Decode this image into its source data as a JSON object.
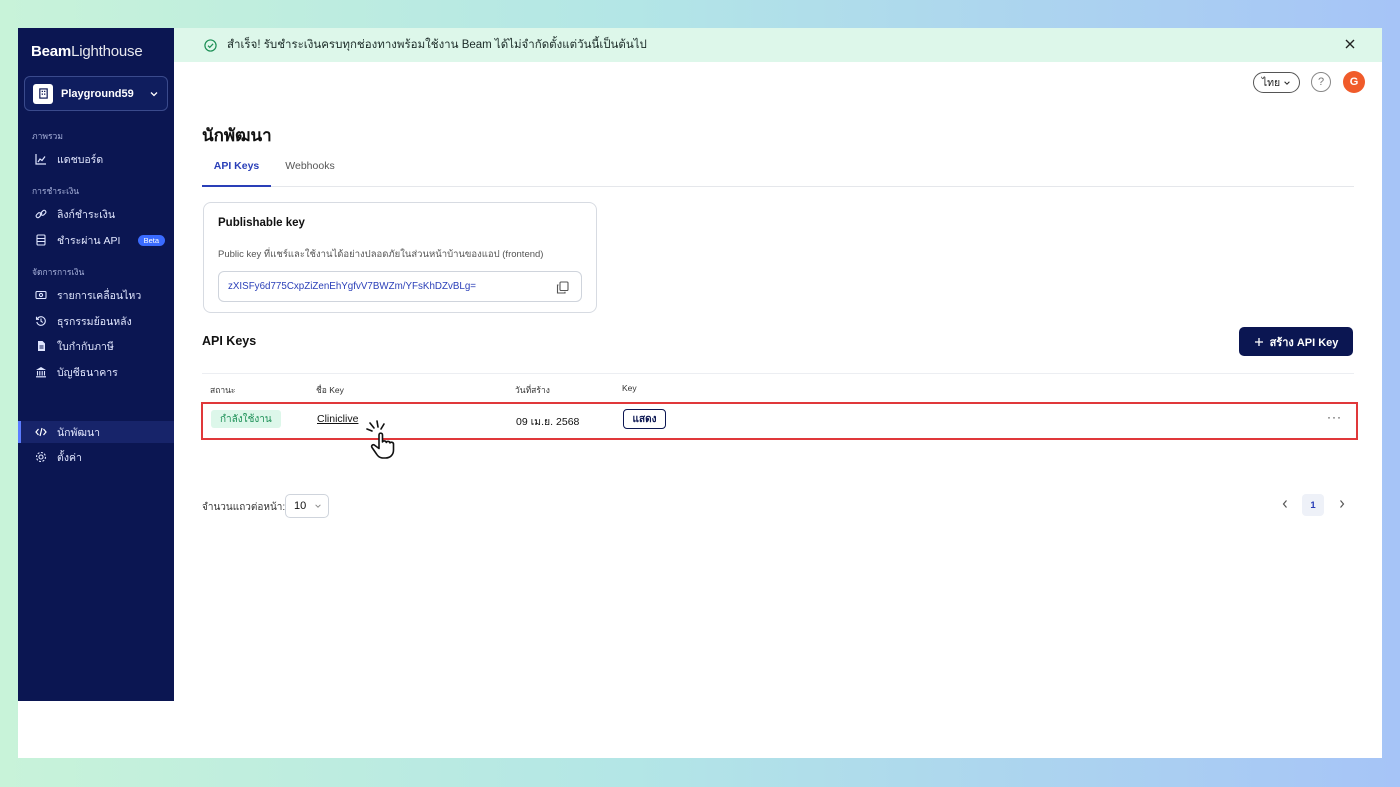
{
  "brand": {
    "bold": "Beam",
    "light": "Lighthouse"
  },
  "workspace": {
    "name": "Playground59"
  },
  "sidebar": {
    "groups": [
      {
        "title": "ภาพรวม",
        "items": [
          {
            "label": "แดชบอร์ด",
            "icon": "chart-icon"
          }
        ]
      },
      {
        "title": "การชำระเงิน",
        "items": [
          {
            "label": "ลิงก์ชำระเงิน",
            "icon": "link-icon"
          },
          {
            "label": "ชำระผ่าน API",
            "icon": "database-icon",
            "badge": "Beta"
          }
        ]
      },
      {
        "title": "จัดการการเงิน",
        "items": [
          {
            "label": "รายการเคลื่อนไหว",
            "icon": "money-icon"
          },
          {
            "label": "ธุรกรรมย้อนหลัง",
            "icon": "history-icon"
          },
          {
            "label": "ใบกำกับภาษี",
            "icon": "document-icon"
          },
          {
            "label": "บัญชีธนาคาร",
            "icon": "bank-icon"
          }
        ]
      }
    ],
    "bottom": [
      {
        "label": "นักพัฒนา",
        "icon": "code-icon",
        "active": true
      },
      {
        "label": "ตั้งค่า",
        "icon": "gear-icon"
      }
    ]
  },
  "banner": {
    "text": "สำเร็จ! รับชำระเงินครบทุกช่องทางพร้อมใช้งาน Beam ได้ไม่จำกัดตั้งแต่วันนี้เป็นต้นไป"
  },
  "topbar": {
    "language": "ไทย",
    "help": "?",
    "avatar": "G"
  },
  "page": {
    "title": "นักพัฒนา",
    "tabs": [
      {
        "label": "API Keys",
        "active": true
      },
      {
        "label": "Webhooks"
      }
    ]
  },
  "publishable": {
    "title": "Publishable key",
    "description": "Public key ที่แชร์และใช้งานได้อย่างปลอดภัยในส่วนหน้าบ้านของแอป (frontend)",
    "value": "zXISFy6d775CxpZiZenEhYgfvV7BWZm/YFsKhDZvBLg="
  },
  "apikeys": {
    "title": "API Keys",
    "create_label": "สร้าง API Key",
    "columns": {
      "status": "สถานะ",
      "name": "ชื่อ Key",
      "created": "วันที่สร้าง",
      "key": "Key"
    },
    "rows": [
      {
        "status": "กำลังใช้งาน",
        "name": "Cliniclive",
        "created": "09 เม.ย. 2568",
        "key_action": "แสดง",
        "more": "···"
      }
    ]
  },
  "pagination": {
    "rows_label": "จำนวนแถวต่อหน้า:",
    "rows_value": "10",
    "current_page": "1"
  }
}
